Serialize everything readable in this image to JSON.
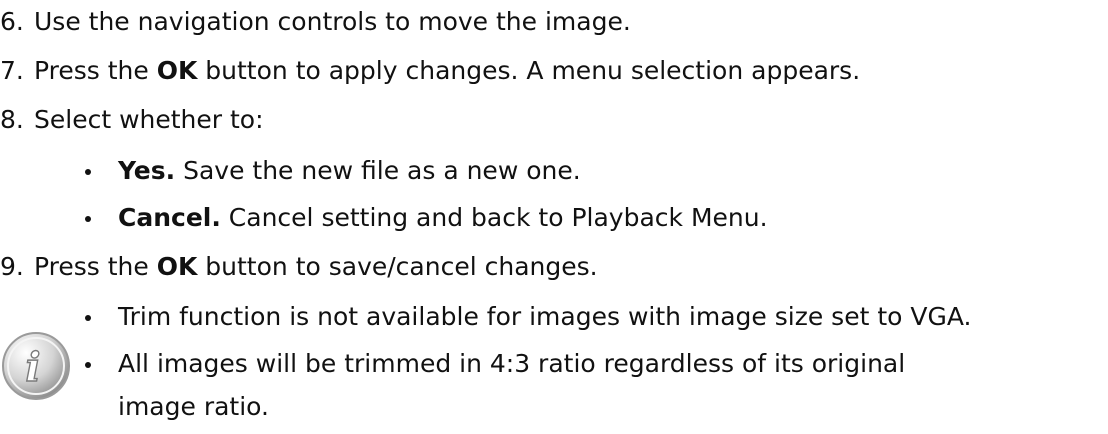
{
  "steps": [
    {
      "number": "6.",
      "parts": [
        {
          "text": "Use the navigation controls to move the image.",
          "bold": false
        }
      ]
    },
    {
      "number": "7.",
      "parts": [
        {
          "text": "Press the ",
          "bold": false
        },
        {
          "text": "OK",
          "bold": true
        },
        {
          "text": " button to apply changes. A menu selection appears.",
          "bold": false
        }
      ]
    },
    {
      "number": "8.",
      "parts": [
        {
          "text": "Select whether to:",
          "bold": false
        }
      ]
    },
    {
      "number": "9.",
      "parts": [
        {
          "text": "Press the ",
          "bold": false
        },
        {
          "text": "OK",
          "bold": true
        },
        {
          "text": " button to save/cancel changes.",
          "bold": false
        }
      ]
    }
  ],
  "options": [
    {
      "label": "Yes.",
      "text": " Save the new file as a new one."
    },
    {
      "label": "Cancel.",
      "text": " Cancel setting and back to Playback Menu."
    }
  ],
  "notes": [
    {
      "text": "Trim function is not available for images with image size set to VGA."
    },
    {
      "text": "All images will be trimmed in 4:3 ratio regardless of its original"
    },
    {
      "text": "image ratio."
    }
  ],
  "icon": {
    "name": "info-note-icon",
    "glyph": "i"
  }
}
